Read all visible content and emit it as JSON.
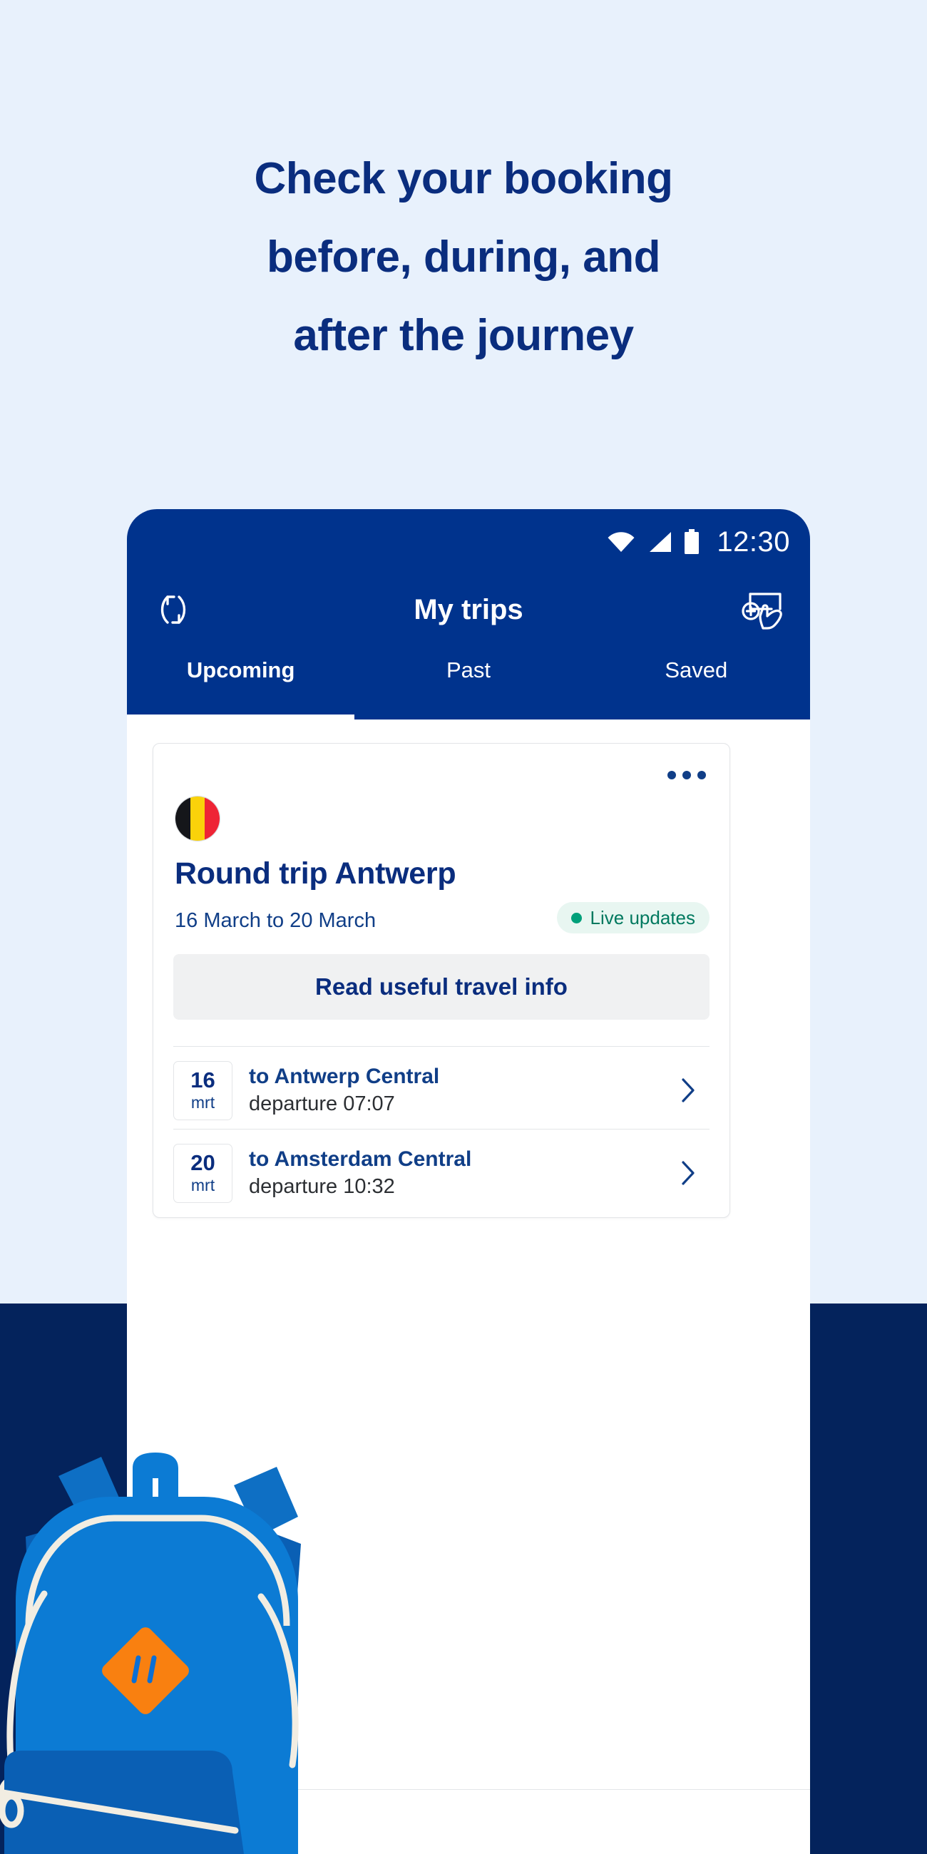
{
  "page": {
    "headline": "Check your booking\nbefore, during, and\nafter the journey",
    "background_color": "#E8F1FC",
    "band_color": "#04235C",
    "headline_color": "#0A2D7E"
  },
  "phone": {
    "status_bar": {
      "time": "12:30",
      "icons": [
        "wifi-icon",
        "signal-icon",
        "battery-icon"
      ],
      "background_color": "#00338D"
    },
    "app_bar": {
      "title": "My trips",
      "left_icon": "refresh-icon",
      "right_icon": "add-ticket-icon"
    },
    "tabs": {
      "items": [
        {
          "label": "Upcoming",
          "active": true
        },
        {
          "label": "Past",
          "active": false
        },
        {
          "label": "Saved",
          "active": false
        }
      ]
    },
    "trip_card": {
      "menu_icon": "more-options-icon",
      "flag": "belgium-flag-icon",
      "title": "Round trip Antwerp",
      "dates": "16 March to 20 March",
      "badge": {
        "label": "Live updates",
        "dot_color": "#00A07A",
        "text_color": "#00795F",
        "background_color": "#E8F6F1"
      },
      "info_button": "Read useful travel info",
      "legs": [
        {
          "day": "16",
          "month": "mrt",
          "destination": "to Antwerp Central",
          "departure": "departure 07:07",
          "chevron": "chevron-right-icon"
        },
        {
          "day": "20",
          "month": "mrt",
          "destination": "to Amsterdam Central",
          "departure": "departure 10:32",
          "chevron": "chevron-right-icon"
        }
      ]
    },
    "bottom_nav": {
      "items": [
        "trips-icon",
        "planner-icon",
        "tickets-icon",
        "menu-icon"
      ]
    }
  },
  "illustration": {
    "name": "backpack-illustration",
    "body_color": "#0C7BD4",
    "pocket_color": "#0A5FB4",
    "strap_color": "#0E6FC4",
    "trim_color": "#F2EDE2",
    "logo_color": "#F98010"
  }
}
